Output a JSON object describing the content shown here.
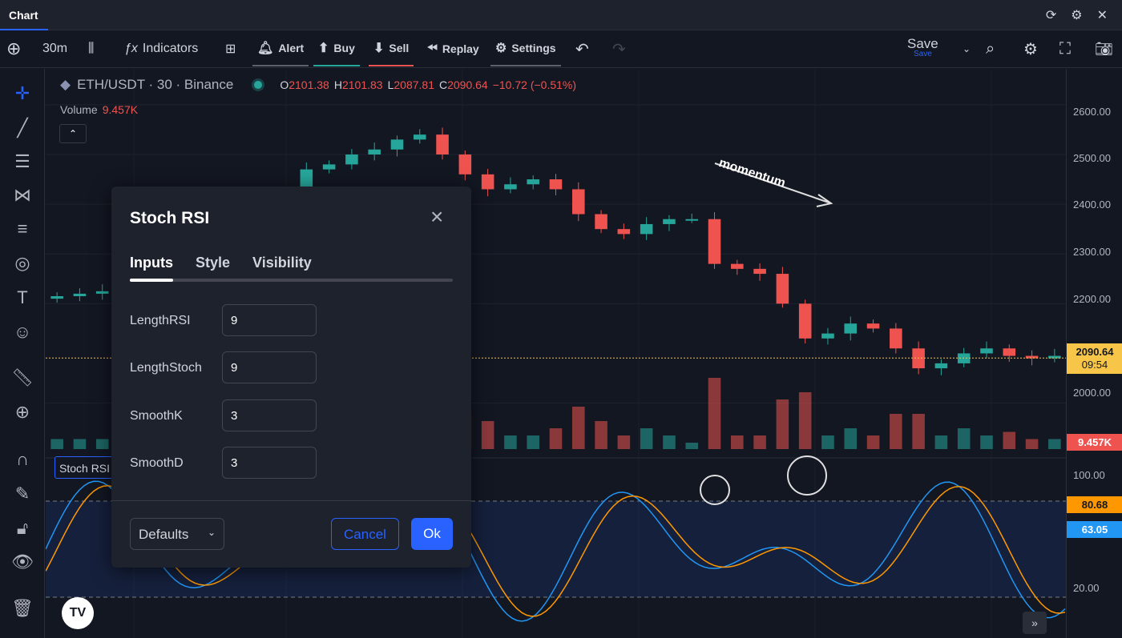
{
  "window": {
    "tab_label": "Chart"
  },
  "toolbar": {
    "timeframe": "30m",
    "indicators_label": "Indicators",
    "alert_label": "Alert",
    "buy_label": "Buy",
    "sell_label": "Sell",
    "replay_label": "Replay",
    "settings_label": "Settings",
    "save_label": "Save",
    "save_sub": "Save"
  },
  "legend": {
    "symbol": "ETH/USDT · 30 · Binance",
    "o_key": "O",
    "o_val": "2101.38",
    "h_key": "H",
    "h_val": "2101.83",
    "l_key": "L",
    "l_val": "2087.81",
    "c_key": "C",
    "c_val": "2090.64",
    "change": "−10.72 (−0.51%)",
    "volume_label": "Volume",
    "volume_value": "9.457K",
    "indicator_label": "Stoch RSI"
  },
  "annotation": "momentum",
  "price_axis": {
    "labels": [
      "2600.00",
      "2500.00",
      "2400.00",
      "2300.00",
      "2200.00",
      "2000.00"
    ],
    "last_price": "2090.64",
    "countdown": "09:54",
    "volume_badge": "9.457K",
    "rsi_labels": [
      "100.00",
      "20.00"
    ],
    "k_value": "80.68",
    "d_value": "63.05"
  },
  "dialog": {
    "title": "Stoch RSI",
    "tabs": [
      "Inputs",
      "Style",
      "Visibility"
    ],
    "fields": [
      {
        "label": "LengthRSI",
        "value": "9"
      },
      {
        "label": "LengthStoch",
        "value": "9"
      },
      {
        "label": "SmoothK",
        "value": "3"
      },
      {
        "label": "SmoothD",
        "value": "3"
      }
    ],
    "defaults_label": "Defaults",
    "cancel_label": "Cancel",
    "ok_label": "Ok"
  },
  "colors": {
    "up": "#26a69a",
    "down": "#ef5350",
    "accent": "#2962ff",
    "stoch_k": "#2196f3",
    "stoch_d": "#ff9800",
    "price_line": "#f7c548"
  },
  "chart_data": {
    "type": "candlestick",
    "series_desc": "ETH/USDT 30m",
    "close_approx": [
      2215,
      2220,
      2225,
      2210,
      2230,
      2250,
      2240,
      2215,
      2200,
      2260,
      2330,
      2470,
      2480,
      2500,
      2510,
      2530,
      2540,
      2500,
      2460,
      2430,
      2440,
      2450,
      2430,
      2380,
      2350,
      2340,
      2360,
      2370,
      2370,
      2280,
      2270,
      2260,
      2200,
      2130,
      2140,
      2160,
      2150,
      2110,
      2070,
      2080,
      2100,
      2110,
      2095,
      2090,
      2095
    ],
    "ylim": [
      1980,
      2640
    ],
    "stoch_ylim": [
      0,
      100
    ],
    "stoch_levels": [
      80,
      20
    ],
    "stoch_k_last": 80.68,
    "stoch_d_last": 63.05
  }
}
